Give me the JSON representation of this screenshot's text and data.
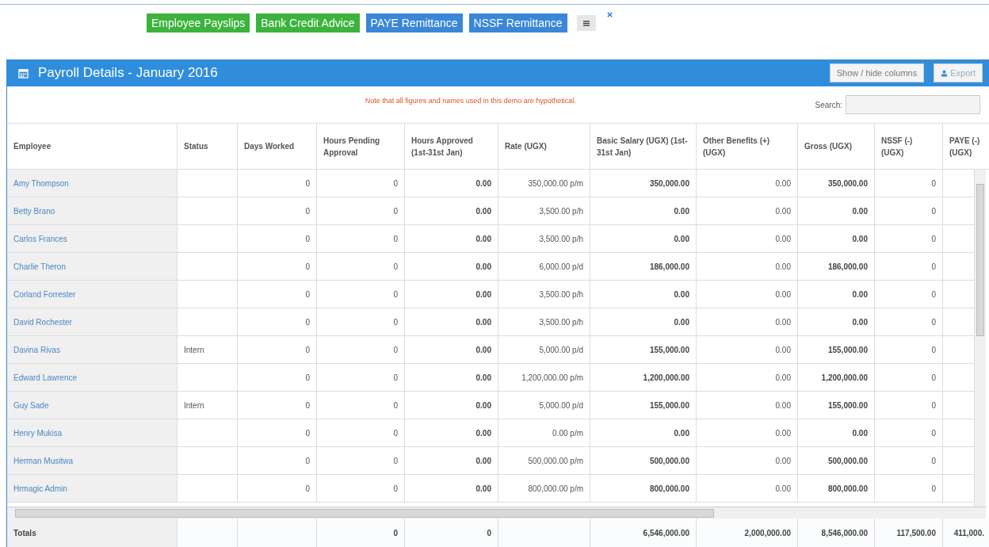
{
  "report_buttons": [
    {
      "label": "Employee Payslips",
      "kind": "green"
    },
    {
      "label": "Bank Credit Advice",
      "kind": "green"
    },
    {
      "label": "PAYE Remittance",
      "kind": "blue"
    },
    {
      "label": "NSSF Remittance",
      "kind": "blue"
    }
  ],
  "panel": {
    "title": "Payroll Details - January 2016",
    "show_hide_label": "Show / hide columns",
    "export_label": "Export"
  },
  "note": "Note that all figures and names used in this demo are hypothetical.",
  "search": {
    "label": "Search:"
  },
  "table": {
    "columns": [
      "Employee",
      "Status",
      "Days Worked",
      "Hours Pending Approval",
      "Hours Approved (1st-31st Jan)",
      "Rate (UGX)",
      "Basic Salary (UGX) (1st-31st Jan)",
      "Other Benefits (+) (UGX)",
      "Gross (UGX)",
      "NSSF (-) (UGX)",
      "PAYE (-) (UGX)"
    ],
    "rows": [
      {
        "employee": "Amy Thompson",
        "days_worked": "0",
        "hours_pending": "0",
        "hours_approved": "0.00",
        "rate": "350,000.00 p/m",
        "basic_salary": "350,000.00",
        "other_benefits": "0.00",
        "gross": "350,000.00",
        "nssf": "0"
      },
      {
        "employee": "Betty Brano",
        "days_worked": "0",
        "hours_pending": "0",
        "hours_approved": "0.00",
        "rate": "3,500.00 p/h",
        "basic_salary": "0.00",
        "other_benefits": "0.00",
        "gross": "0.00",
        "nssf": "0"
      },
      {
        "employee": "Carlos Frances",
        "days_worked": "0",
        "hours_pending": "0",
        "hours_approved": "0.00",
        "rate": "3,500.00 p/h",
        "basic_salary": "0.00",
        "other_benefits": "0.00",
        "gross": "0.00",
        "nssf": "0"
      },
      {
        "employee": "Charlie Theron",
        "days_worked": "0",
        "hours_pending": "0",
        "hours_approved": "0.00",
        "rate": "6,000.00 p/d",
        "basic_salary": "186,000.00",
        "other_benefits": "0.00",
        "gross": "186,000.00",
        "nssf": "0"
      },
      {
        "employee": "Corland Forrester",
        "days_worked": "0",
        "hours_pending": "0",
        "hours_approved": "0.00",
        "rate": "3,500.00 p/h",
        "basic_salary": "0.00",
        "other_benefits": "0.00",
        "gross": "0.00",
        "nssf": "0"
      },
      {
        "employee": "David Rochester",
        "days_worked": "0",
        "hours_pending": "0",
        "hours_approved": "0.00",
        "rate": "3,500.00 p/h",
        "basic_salary": "0.00",
        "other_benefits": "0.00",
        "gross": "0.00",
        "nssf": "0"
      },
      {
        "employee": "Davina Rivas",
        "status": "Intern",
        "days_worked": "0",
        "hours_pending": "0",
        "hours_approved": "0.00",
        "rate": "5,000.00 p/d",
        "basic_salary": "155,000.00",
        "other_benefits": "0.00",
        "gross": "155,000.00",
        "nssf": "0"
      },
      {
        "employee": "Edward Lawrence",
        "days_worked": "0",
        "hours_pending": "0",
        "hours_approved": "0.00",
        "rate": "1,200,000.00 p/m",
        "basic_salary": "1,200,000.00",
        "other_benefits": "0.00",
        "gross": "1,200,000.00",
        "nssf": "0"
      },
      {
        "employee": "Guy Sade",
        "status": "Intern",
        "days_worked": "0",
        "hours_pending": "0",
        "hours_approved": "0.00",
        "rate": "5,000.00 p/d",
        "basic_salary": "155,000.00",
        "other_benefits": "0.00",
        "gross": "155,000.00",
        "nssf": "0"
      },
      {
        "employee": "Henry Mukisa",
        "days_worked": "0",
        "hours_pending": "0",
        "hours_approved": "0.00",
        "rate": "0.00 p/m",
        "basic_salary": "0.00",
        "other_benefits": "0.00",
        "gross": "0.00",
        "nssf": "0"
      },
      {
        "employee": "Herman Musitwa",
        "days_worked": "0",
        "hours_pending": "0",
        "hours_approved": "0.00",
        "rate": "500,000.00 p/m",
        "basic_salary": "500,000.00",
        "other_benefits": "0.00",
        "gross": "500,000.00",
        "nssf": "0"
      },
      {
        "employee": "Hrmagic Admin",
        "days_worked": "0",
        "hours_pending": "0",
        "hours_approved": "0.00",
        "rate": "800,000.00 p/m",
        "basic_salary": "800,000.00",
        "other_benefits": "0.00",
        "gross": "800,000.00",
        "nssf": "0"
      }
    ],
    "totals": {
      "label": "Totals",
      "hours_pending": "0",
      "hours_approved": "0",
      "basic_salary": "6,546,000.00",
      "other_benefits": "2,000,000.00",
      "gross": "8,546,000.00",
      "nssf": "117,500.00",
      "paye": "411,000."
    }
  }
}
